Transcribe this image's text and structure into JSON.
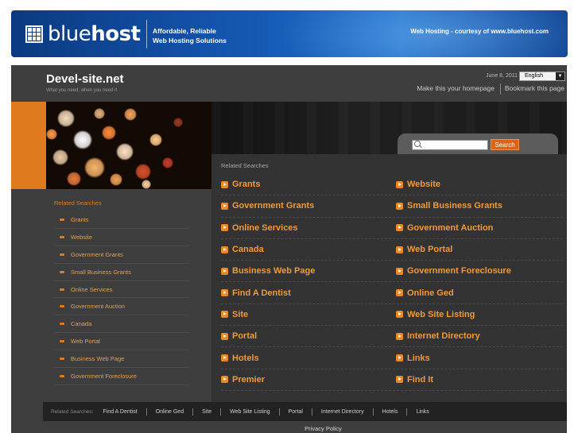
{
  "banner": {
    "logo_word_light": "blue",
    "logo_word_bold": "host",
    "tagline_line1": "Affordable, Reliable",
    "tagline_line2": "Web Hosting Solutions",
    "courtesy": "Web Hosting - courtesy of www.bluehost.com"
  },
  "header": {
    "site_title": "Devel-site.net",
    "site_subtitle": "What you need, when you need it",
    "date": "June 8, 2011",
    "language": "English",
    "home_link": "Make this your homepage",
    "bookmark_link": "Bookmark this page"
  },
  "search": {
    "placeholder": "",
    "button_label": "Search"
  },
  "sidebar": {
    "title": "Related Searches",
    "items": [
      "Grants",
      "Website",
      "Government Grants",
      "Small Business Grants",
      "Online Services",
      "Government Auction",
      "Canada",
      "Web Portal",
      "Business Web Page",
      "Government Foreclosure"
    ]
  },
  "main": {
    "title": "Related Searches",
    "rows": [
      [
        "Grants",
        "Website"
      ],
      [
        "Government Grants",
        "Small Business Grants"
      ],
      [
        "Online Services",
        "Government Auction"
      ],
      [
        "Canada",
        "Web Portal"
      ],
      [
        "Business Web Page",
        "Government Foreclosure"
      ],
      [
        "Find A Dentist",
        "Online Ged"
      ],
      [
        "Site",
        "Web Site Listing"
      ],
      [
        "Portal",
        "Internet Directory"
      ],
      [
        "Hotels",
        "Links"
      ],
      [
        "Premier",
        "Find It"
      ]
    ]
  },
  "footer": {
    "label": "Related Searches:",
    "links": [
      "Find A Dentist",
      "Online Ged",
      "Site",
      "Web Site Listing",
      "Portal",
      "Internet Directory",
      "Hotels",
      "Links"
    ],
    "privacy": "Privacy Policy"
  },
  "colors": {
    "accent": "#e07a1e",
    "background": "#3e3e3e",
    "banner": "#1559b5"
  }
}
